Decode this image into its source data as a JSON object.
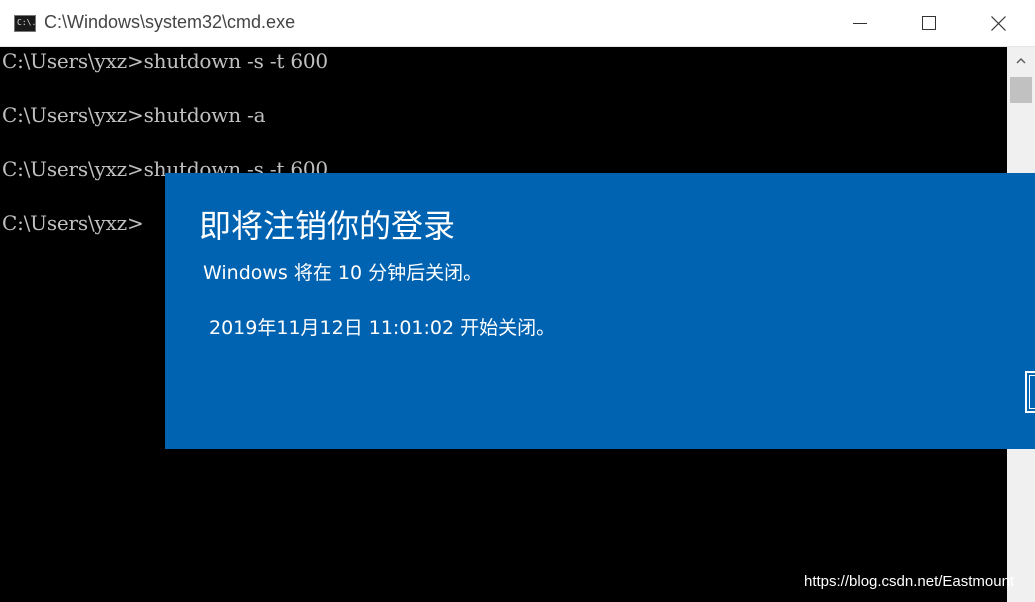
{
  "window": {
    "title": "C:\\Windows\\system32\\cmd.exe",
    "icon_text": "C:\\."
  },
  "console": {
    "lines": [
      "C:\\Users\\yxz>shutdown -s -t 600",
      "C:\\Users\\yxz>shutdown -a",
      "C:\\Users\\yxz>shutdown -s -t 600",
      "C:\\Users\\yxz>"
    ],
    "text_color": "#c0c0c0",
    "background": "#000000"
  },
  "dialog": {
    "title": "即将注销你的登录",
    "message": "Windows 将在 10 分钟后关闭。",
    "time": "2019年11月12日 11:01:02 开始关闭。",
    "background": "#0063b1"
  },
  "watermark": "https://blog.csdn.net/Eastmount",
  "icons": {
    "app": "cmd-icon",
    "minimize": "minimize-icon",
    "maximize": "maximize-icon",
    "close": "close-icon",
    "scroll_up": "chevron-up-icon"
  }
}
